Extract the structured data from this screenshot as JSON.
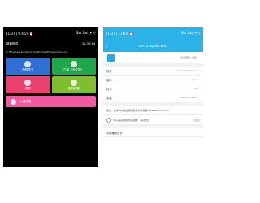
{
  "left": {
    "status_time": "11:37 | 0.4K/s ⏰",
    "status_signal": "Sat Sat ◔ ⓔ",
    "title": "跳转推送",
    "title_time": "11:37:14",
    "url": "ar ffme.hpq/alaylecd/cm/dlhwi/se/fi@example.com",
    "tiles": [
      {
        "label": "视频学习",
        "color": "#2f6fd6"
      },
      {
        "label": "白板（全文档）",
        "color": "#1fa84a"
      },
      {
        "label": "调制",
        "color": "#e8406f"
      },
      {
        "label": "变更设置",
        "color": "#7fbf2f"
      }
    ],
    "wide_label": "一键设置"
  },
  "right": {
    "status_time": "11:37 | 1.0K/s ⏰",
    "status_signal": "Sat Sat ◔ ⓔ",
    "header_title": "com.xxxplan.xxx",
    "rows": [
      {
        "label": "",
        "value": "应用图标_白板",
        "arrow": "›"
      },
      {
        "label": "包名",
        "value": "com.xxxplan.xxx",
        "arrow": "›"
      },
      {
        "label": "版本",
        "value": "1.0",
        "arrow": "›"
      },
      {
        "label": "标识",
        "value": "35",
        "arrow": "›"
      },
      {
        "label": "安装",
        "value": "Android 9.0.1",
        "arrow": "›"
      }
    ],
    "note1": "备注：更多app信息请到应用详情查看www.appinfo.com",
    "note2": "Yapp是否启用加速服务（实验性）",
    "footer": "可能偏移设计"
  }
}
